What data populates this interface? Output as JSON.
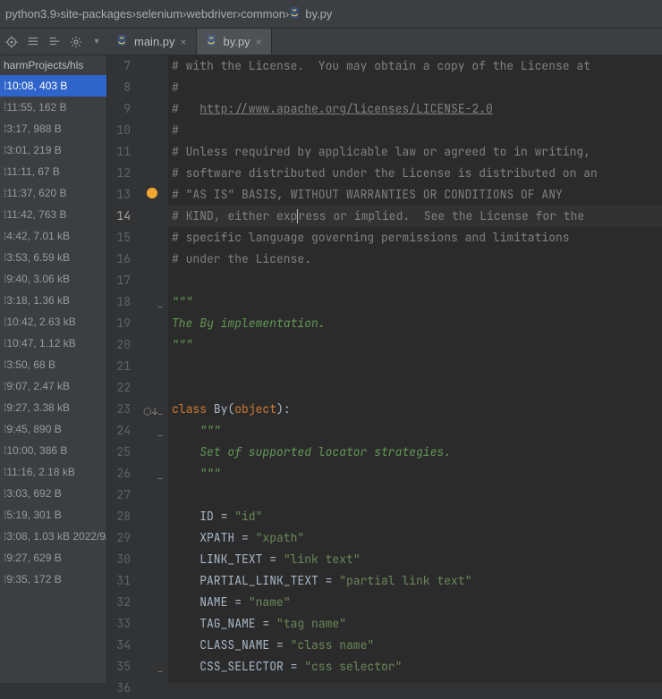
{
  "breadcrumb": [
    "python3.9",
    "site-packages",
    "selenium",
    "webdriver",
    "common",
    "by.py"
  ],
  "tabs": [
    {
      "label": "main.py",
      "active": false
    },
    {
      "label": "by.py",
      "active": true
    }
  ],
  "sidebar": {
    "head": "harmProjects/hls",
    "items": [
      {
        "t": "10:08, 403 B",
        "sel": true
      },
      {
        "t": "11:55, 162 B"
      },
      {
        "t": "3:17, 988 B"
      },
      {
        "t": "3:01, 219 B"
      },
      {
        "t": "11:11, 67 B"
      },
      {
        "t": "11:37, 620 B"
      },
      {
        "t": "11:42, 763 B"
      },
      {
        "t": "4:42, 7.01 kB"
      },
      {
        "t": "3:53, 6.59 kB"
      },
      {
        "t": "9:40, 3.06 kB"
      },
      {
        "t": "3:18, 1.36 kB"
      },
      {
        "t": "10:42, 2.63 kB"
      },
      {
        "t": "10:47, 1.12 kB"
      },
      {
        "t": "3:50, 68 B"
      },
      {
        "t": "9:07, 2.47 kB"
      },
      {
        "t": "9:27, 3.38 kB"
      },
      {
        "t": "9:45, 890 B"
      },
      {
        "t": "10:00, 386 B"
      },
      {
        "t": "11:16, 2.18 kB"
      },
      {
        "t": "3:03, 692 B"
      },
      {
        "t": "5:19, 301 B"
      },
      {
        "t": "3:08, 1.03 kB 2022/9/"
      },
      {
        "t": "9:27, 629 B"
      },
      {
        "t": "9:35, 172 B"
      }
    ]
  },
  "code": {
    "start": 7,
    "current": 14,
    "lines": {
      "7": {
        "segs": [
          [
            "# with the License.  You may obtain a copy of the License at",
            "comment"
          ]
        ]
      },
      "8": {
        "segs": [
          [
            "#",
            "comment"
          ]
        ]
      },
      "9": {
        "segs": [
          [
            "#   ",
            "comment"
          ],
          [
            "http://www.apache.org/licenses/LICENSE-2.0",
            "link"
          ]
        ]
      },
      "10": {
        "segs": [
          [
            "#",
            "comment"
          ]
        ]
      },
      "11": {
        "segs": [
          [
            "# Unless required by applicable law or agreed to in writing,",
            "comment"
          ]
        ]
      },
      "12": {
        "segs": [
          [
            "# software distributed under the License is distributed on an",
            "comment"
          ]
        ]
      },
      "13": {
        "segs": [
          [
            "# \"AS IS\" BASIS, WITHOUT WARRANTIES OR CONDITIONS OF ANY",
            "comment"
          ]
        ],
        "bulb": true
      },
      "14": {
        "segs": [
          [
            "# KIND, either exp",
            "comment"
          ],
          [
            "",
            "caret"
          ],
          [
            "ress or implied.  See the License for the",
            "comment"
          ]
        ],
        "hl": true
      },
      "15": {
        "segs": [
          [
            "# specific language governing permissions and limitations",
            "comment"
          ]
        ]
      },
      "16": {
        "segs": [
          [
            "# under the License.",
            "comment"
          ]
        ]
      },
      "17": {
        "segs": []
      },
      "18": {
        "segs": [
          [
            "\"\"\"",
            "str"
          ]
        ],
        "fold": "⊟"
      },
      "19": {
        "segs": [
          [
            "The By implementation.",
            "str"
          ]
        ]
      },
      "20": {
        "segs": [
          [
            "\"\"\"",
            "str"
          ]
        ]
      },
      "21": {
        "segs": []
      },
      "22": {
        "segs": []
      },
      "23": {
        "segs": [
          [
            "class ",
            "kw"
          ],
          [
            "By",
            "plain"
          ],
          [
            "(",
            "plain"
          ],
          [
            "object",
            "kw"
          ],
          [
            "):",
            "plain"
          ]
        ],
        "fold": "⊟",
        "over": "⬡↓"
      },
      "24": {
        "segs": [
          [
            "    ",
            "plain"
          ],
          [
            "\"\"\"",
            "str"
          ]
        ],
        "fold": "⊟"
      },
      "25": {
        "segs": [
          [
            "    ",
            "plain"
          ],
          [
            "Set of supported locator strategies.",
            "str"
          ]
        ]
      },
      "26": {
        "segs": [
          [
            "    ",
            "plain"
          ],
          [
            "\"\"\"",
            "str"
          ]
        ],
        "fold": "⊟"
      },
      "27": {
        "segs": []
      },
      "28": {
        "segs": [
          [
            "    ID = ",
            "plain"
          ],
          [
            "\"id\"",
            "lit"
          ]
        ]
      },
      "29": {
        "segs": [
          [
            "    XPATH = ",
            "plain"
          ],
          [
            "\"xpath\"",
            "lit"
          ]
        ]
      },
      "30": {
        "segs": [
          [
            "    LINK_TEXT = ",
            "plain"
          ],
          [
            "\"link text\"",
            "lit"
          ]
        ]
      },
      "31": {
        "segs": [
          [
            "    PARTIAL_LINK_TEXT = ",
            "plain"
          ],
          [
            "\"partial link text\"",
            "lit"
          ]
        ]
      },
      "32": {
        "segs": [
          [
            "    NAME = ",
            "plain"
          ],
          [
            "\"name\"",
            "lit"
          ]
        ]
      },
      "33": {
        "segs": [
          [
            "    TAG_NAME = ",
            "plain"
          ],
          [
            "\"tag name\"",
            "lit"
          ]
        ]
      },
      "34": {
        "segs": [
          [
            "    CLASS_NAME = ",
            "plain"
          ],
          [
            "\"class name\"",
            "lit"
          ]
        ]
      },
      "35": {
        "segs": [
          [
            "    CSS_SELECTOR = ",
            "plain"
          ],
          [
            "\"css selector\"",
            "lit"
          ]
        ],
        "fold": "⊟"
      },
      "36": {
        "segs": []
      }
    }
  }
}
